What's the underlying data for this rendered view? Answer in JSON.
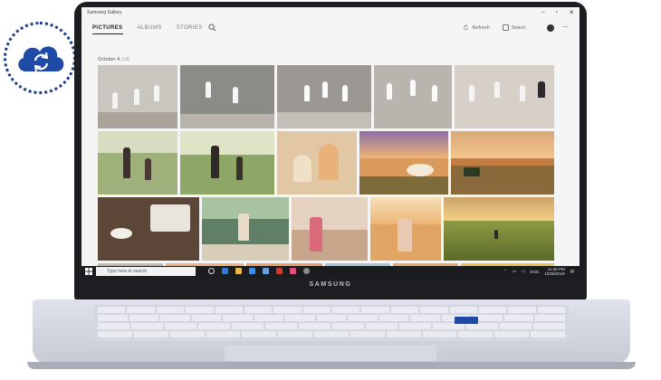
{
  "window": {
    "title": "Samsung Gallery",
    "controls": [
      "–",
      "▫",
      "✕"
    ]
  },
  "tabs": [
    {
      "label": "PICTURES",
      "active": true
    },
    {
      "label": "ALBUMS",
      "active": false
    },
    {
      "label": "STORIES",
      "active": false
    }
  ],
  "toolbar": {
    "refresh_label": "Refresh",
    "select_label": "Select"
  },
  "gallery": {
    "date_label": "October 4",
    "date_count": "(14)"
  },
  "taskbar": {
    "search_placeholder": "Type here to search",
    "language": "ENG",
    "time": "11:36 PM",
    "date": "10/26/2019"
  },
  "device": {
    "brand": "SAMSUNG"
  },
  "colors": {
    "cloud_badge": "#1b3f8f",
    "accent": "#1f4aa8"
  },
  "icons": [
    "cloud-sync-icon",
    "search-icon",
    "refresh-icon",
    "select-icon",
    "account-icon",
    "more-icon",
    "windows-start-icon"
  ]
}
